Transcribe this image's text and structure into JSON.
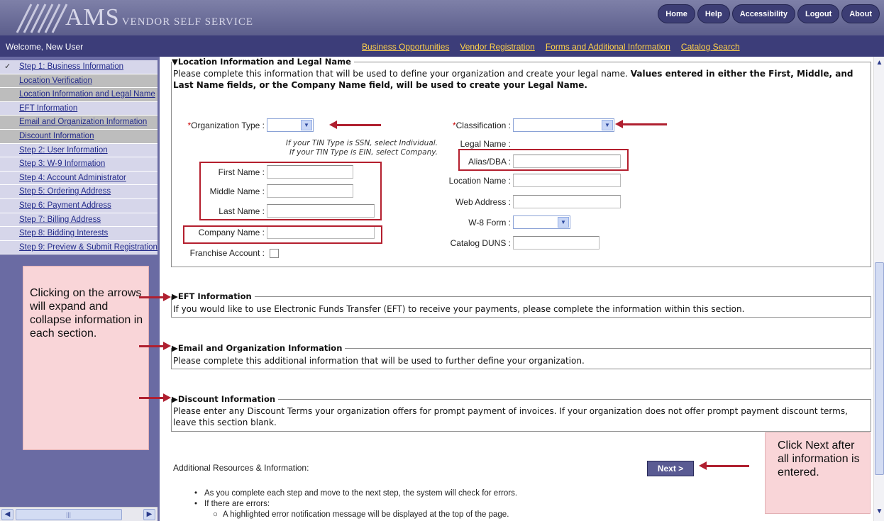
{
  "header": {
    "logo_big": "AMS",
    "logo_title": "Vendor Self Service",
    "buttons": [
      "Home",
      "Help",
      "Accessibility",
      "Logout",
      "About"
    ]
  },
  "navbar": {
    "welcome": "Welcome, New User",
    "links": [
      "Business Opportunities",
      "Vendor Registration",
      "Forms and Additional Information",
      "Catalog Search"
    ]
  },
  "sidebar": {
    "items": [
      {
        "label": "Step 1: Business Information",
        "checked": true
      },
      {
        "label": "Location Verification"
      },
      {
        "label": "Location Information and Legal Name"
      },
      {
        "label": "EFT Information"
      },
      {
        "label": "Email and Organization Information"
      },
      {
        "label": "Discount Information"
      },
      {
        "label": "Step 2: User Information"
      },
      {
        "label": "Step 3: W-9 Information"
      },
      {
        "label": "Step 4: Account Administrator"
      },
      {
        "label": "Step 5: Ordering Address"
      },
      {
        "label": "Step 6: Payment Address"
      },
      {
        "label": "Step 7: Billing Address"
      },
      {
        "label": "Step 8: Bidding Interests"
      },
      {
        "label": "Step 9: Preview & Submit Registration"
      }
    ]
  },
  "location": {
    "legend": "▼Location Information and Legal Name",
    "desc_plain": "Please complete this information that will be used to define your organization and create your legal name. ",
    "desc_bold": "Values entered in either the First, Middle, and Last Name fields, or the Company Name field, will be used to create your Legal Name.",
    "org_type_label": "Organization Type :",
    "hint_line1": "If your TIN Type is SSN, select Individual.",
    "hint_line2": "If your TIN Type is EIN, select Company.",
    "first_name_label": "First Name :",
    "middle_name_label": "Middle Name :",
    "last_name_label": "Last Name :",
    "company_name_label": "Company Name :",
    "franchise_label": "Franchise Account :",
    "classification_label": "Classification :",
    "legal_name_label": "Legal Name :",
    "alias_label": "Alias/DBA :",
    "location_name_label": "Location Name :",
    "web_address_label": "Web Address :",
    "w8_label": "W-8 Form :",
    "catalog_duns_label": "Catalog DUNS :",
    "required_mark": "*"
  },
  "eft": {
    "legend": "▶EFT Information",
    "desc": "If you would like to use Electronic Funds Transfer (EFT) to receive your payments, please complete the information within this section."
  },
  "email_org": {
    "legend": "▶Email and Organization Information",
    "desc": "Please complete this additional information that will be used to further define your organization."
  },
  "discount": {
    "legend": "▶Discount Information",
    "desc": "Please enter any Discount Terms your organization offers for prompt payment of invoices. If your organization does not offer prompt payment discount terms, leave this section blank."
  },
  "callouts": {
    "expand": "Clicking on the arrows will expand and collapse information in each section.",
    "next": "Click Next after all information is entered."
  },
  "footer": {
    "additional_resources": "Additional Resources & Information:",
    "next_label": "Next >",
    "bullet1": "As you complete each step and move to the next step, the system will check for errors.",
    "bullet2": "If there are errors:",
    "sub_bullet1": "A highlighted error notification message will be displayed at the top of the page."
  },
  "colors": {
    "header": "#6d6f9d",
    "navbar": "#3c3d79",
    "sidebar": "#6a6ba3",
    "link_yellow": "#ffd24a",
    "annotation_red": "#b02030",
    "callout_pink": "#f9d5d8"
  },
  "icons": [
    "check-icon",
    "dropdown-arrow-icon",
    "scroll-left-icon",
    "scroll-right-icon",
    "scroll-up-icon",
    "scroll-down-icon",
    "annotation-arrow-icon"
  ]
}
